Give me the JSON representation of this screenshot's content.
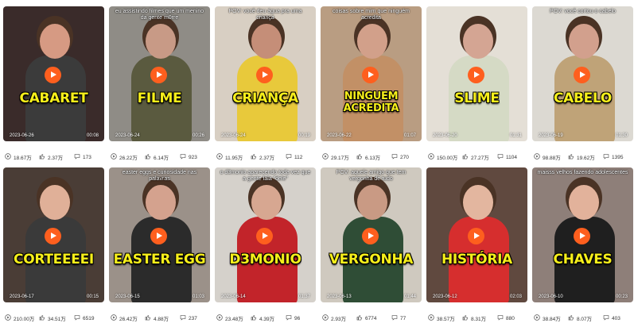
{
  "videos": [
    {
      "caption": "",
      "title": "CABARET",
      "date": "2023-06-26",
      "duration": "00:08",
      "plays": "18.67万",
      "likes": "2.37万",
      "comments": "173",
      "bg": "#3a2b2a",
      "body": "#3b3b3b",
      "head": "#d69a83"
    },
    {
      "caption": "eu assistindo filmes que um menino da gente m0rre",
      "title": "FILME",
      "date": "2023-06-24",
      "duration": "00:26",
      "plays": "26.22万",
      "likes": "6.14万",
      "comments": "923",
      "bg": "#8f8c86",
      "body": "#5a5a3f",
      "head": "#c89a86"
    },
    {
      "caption": "POV: você deu água pra uma criança",
      "title": "CRIANÇA",
      "date": "2023-06-24",
      "duration": "00:19",
      "plays": "11.95万",
      "likes": "2.37万",
      "comments": "112",
      "bg": "#d8cfc3",
      "body": "#e8c93b",
      "head": "#c58e78"
    },
    {
      "caption": "coisas sobre mim que ninguém acredita",
      "title": "NINGUEM ACREDITA",
      "date": "2023-06-22",
      "duration": "01:07",
      "plays": "29.17万",
      "likes": "6.13万",
      "comments": "270",
      "bg": "#b99d82",
      "body": "#c29066",
      "head": "#d2a08a"
    },
    {
      "caption": "",
      "title": "SLIME",
      "date": "2023-06-20",
      "duration": "01:31",
      "plays": "150.00万",
      "likes": "27.27万",
      "comments": "1104",
      "bg": "#e4dfd6",
      "body": "#d5dac5",
      "head": "#d4a593"
    },
    {
      "caption": "POV: você cortou o cabelo",
      "title": "CABELO",
      "date": "2023-06-19",
      "duration": "01:30",
      "plays": "98.88万",
      "likes": "19.62万",
      "comments": "1395",
      "bg": "#dcd9d2",
      "body": "#bfa378",
      "head": "#d2a08d"
    },
    {
      "caption": "",
      "title": "CORTEEEEI",
      "date": "2023-06-17",
      "duration": "00:15",
      "plays": "210.00万",
      "likes": "34.51万",
      "comments": "6519",
      "bg": "#4a3d36",
      "body": "#3a3a3a",
      "head": "#e0b098"
    },
    {
      "caption": "easter eggs e curiosidade nas palavras",
      "title": "EASTER EGG",
      "date": "2023-06-15",
      "duration": "01:03",
      "plays": "26.42万",
      "likes": "4.88万",
      "comments": "237",
      "bg": "#9b9189",
      "body": "#2b2b2b",
      "head": "#d4a28e"
    },
    {
      "caption": "o d3monio aparecendo toda vez que a gente fala \"dele\"",
      "title": "D3MONIO",
      "date": "2023-06-14",
      "duration": "01:37",
      "plays": "23.48万",
      "likes": "4.39万",
      "comments": "96",
      "bg": "#d5d1cb",
      "body": "#c2242a",
      "head": "#d7a791"
    },
    {
      "caption": "POV: aquele amigo que tem vergonha de tudo",
      "title": "VERGONHA",
      "date": "2023-06-13",
      "duration": "01:44",
      "plays": "2.93万",
      "likes": "6774",
      "comments": "77",
      "bg": "#cfc9bf",
      "body": "#2f4d36",
      "head": "#c99a84"
    },
    {
      "caption": "",
      "title": "HISTÓRIA",
      "date": "2023-06-12",
      "duration": "02:03",
      "plays": "38.57万",
      "likes": "8.31万",
      "comments": "880",
      "bg": "#60493f",
      "body": "#d62e2e",
      "head": "#e3b69f"
    },
    {
      "caption": "maisss velhos fazendo adolescentes",
      "title": "CHAVES",
      "date": "2023-06-10",
      "duration": "00:23",
      "plays": "38.84万",
      "likes": "8.07万",
      "comments": "403",
      "bg": "#8e7f79",
      "body": "#1f1f1f",
      "head": "#e2b29b"
    }
  ]
}
